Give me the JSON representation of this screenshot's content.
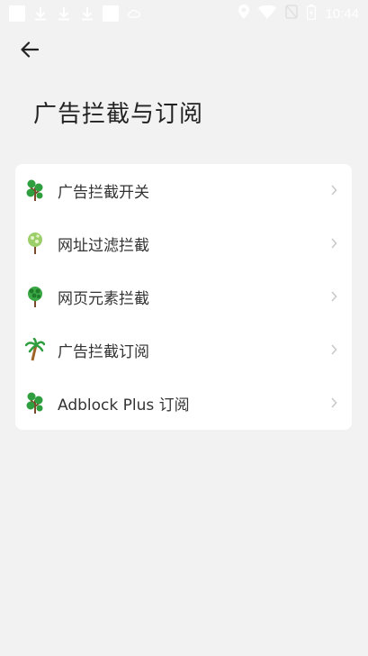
{
  "status_bar": {
    "time": "10:44",
    "icons": [
      "square-notification-icon",
      "download-icon",
      "download-icon",
      "download-icon",
      "square-notification-icon",
      "cloud-icon",
      "location-icon",
      "wifi-icon",
      "sim-off-icon",
      "battery-icon"
    ]
  },
  "header": {
    "back_icon": "arrow-left-icon",
    "title": "广告拦截与订阅"
  },
  "menu": {
    "items": [
      {
        "label": "广告拦截开关",
        "icon": "tree-icon"
      },
      {
        "label": "网址过滤拦截",
        "icon": "tree-icon"
      },
      {
        "label": "网页元素拦截",
        "icon": "tree-icon"
      },
      {
        "label": "广告拦截订阅",
        "icon": "palm-tree-icon"
      },
      {
        "label": "Adblock Plus 订阅",
        "icon": "tree-icon"
      }
    ],
    "chevron_icon": "chevron-right-icon"
  },
  "colors": {
    "background": "#f2f2f2",
    "card": "#ffffff",
    "title": "#222222",
    "label": "#333333",
    "chevron": "#c8c8c8",
    "icon_green": "#2e9e3e",
    "icon_trunk": "#7a4a2a"
  }
}
